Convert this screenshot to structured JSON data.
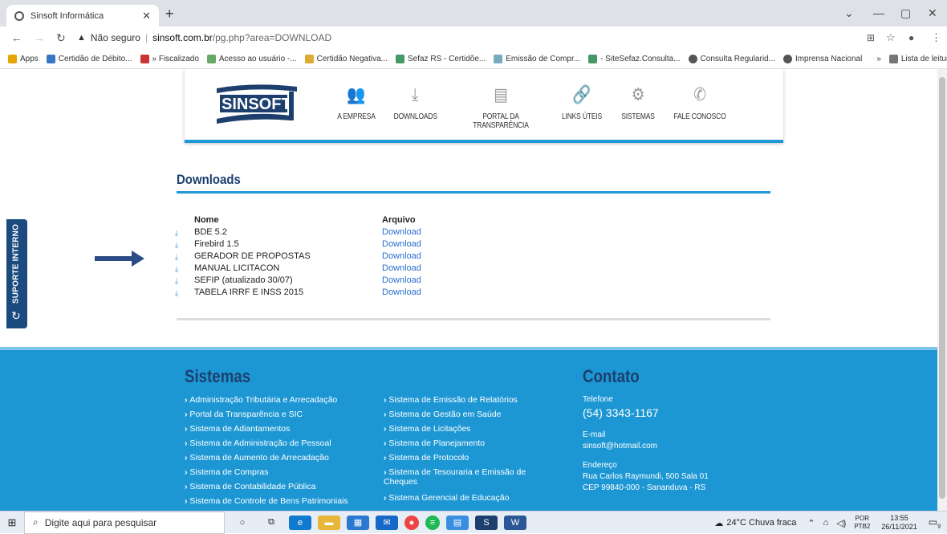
{
  "browser": {
    "tab_title": "Sinsoft Informática",
    "new_tab": "+",
    "not_secure": "Não seguro",
    "host": "sinsoft.com.br",
    "path": "/pg.php?area=DOWNLOAD",
    "bookmarks": [
      "Apps",
      "Certidão de Débito...",
      "» Fiscalizado",
      "Acesso ao usuário -...",
      "Certidão Negativa...",
      "Sefaz RS - Certidõe...",
      "Emissão de Compr...",
      "- SiteSefaz.Consulta...",
      "Consulta Regularid...",
      "Imprensa Nacional",
      "»",
      "Lista de leitura"
    ]
  },
  "site": {
    "logo_text": "SINSOFT",
    "nav": [
      "A EMPRESA",
      "DOWNLOADS",
      "PORTAL DA TRANSPARÊNCIA",
      "LINKS ÚTEIS",
      "SISTEMAS",
      "FALE CONOSCO"
    ],
    "side_tab": "SUPORTE INTERNO"
  },
  "downloads": {
    "title": "Downloads",
    "col_name": "Nome",
    "col_file": "Arquivo",
    "rows": [
      {
        "name": "BDE 5.2",
        "link": "Download"
      },
      {
        "name": "Firebird 1.5",
        "link": "Download"
      },
      {
        "name": "GERADOR DE PROPOSTAS",
        "link": "Download"
      },
      {
        "name": "MANUAL LICITACON",
        "link": "Download"
      },
      {
        "name": "SEFIP (atualizado 30/07)",
        "link": "Download"
      },
      {
        "name": "TABELA IRRF E INSS 2015",
        "link": "Download"
      }
    ]
  },
  "footer": {
    "systems_title": "Sistemas",
    "col1": [
      "Administração Tributária e Arrecadação",
      "Portal da Transparência e SIC",
      "Sistema de Adiantamentos",
      "Sistema de Administração de Pessoal",
      "Sistema de Aumento de Arrecadação",
      "Sistema de Compras",
      "Sistema de Contabilidade Pública",
      "Sistema de Controle de Bens Patrimoniais"
    ],
    "col2": [
      "Sistema de Emissão de Relatórios",
      "Sistema de Gestão em Saúde",
      "Sistema de Licitações",
      "Sistema de Planejamento",
      "Sistema de Protocolo",
      "Sistema de Tesouraria e Emissão de",
      "Cheques",
      "Sistema Gerencial de Educação"
    ],
    "contact_title": "Contato",
    "phone_label": "Telefone",
    "phone": "(54) 3343-1167",
    "email_label": "E-mail",
    "email": "sinsoft@hotmail.com",
    "address_label": "Endereço",
    "address1": "Rua Carlos Raymundi, 500 Sala 01",
    "address2": "CEP 99840-000 - Sananduva - RS"
  },
  "taskbar": {
    "search_placeholder": "Digite aqui para pesquisar",
    "weather": "24°C  Chuva fraca",
    "lang1": "POR",
    "lang2": "PTB2",
    "time": "13:55",
    "date": "26/11/2021",
    "notif_count": "9"
  },
  "colors": {
    "accent": "#1d97d4",
    "dark_blue": "#1c3f6e"
  }
}
